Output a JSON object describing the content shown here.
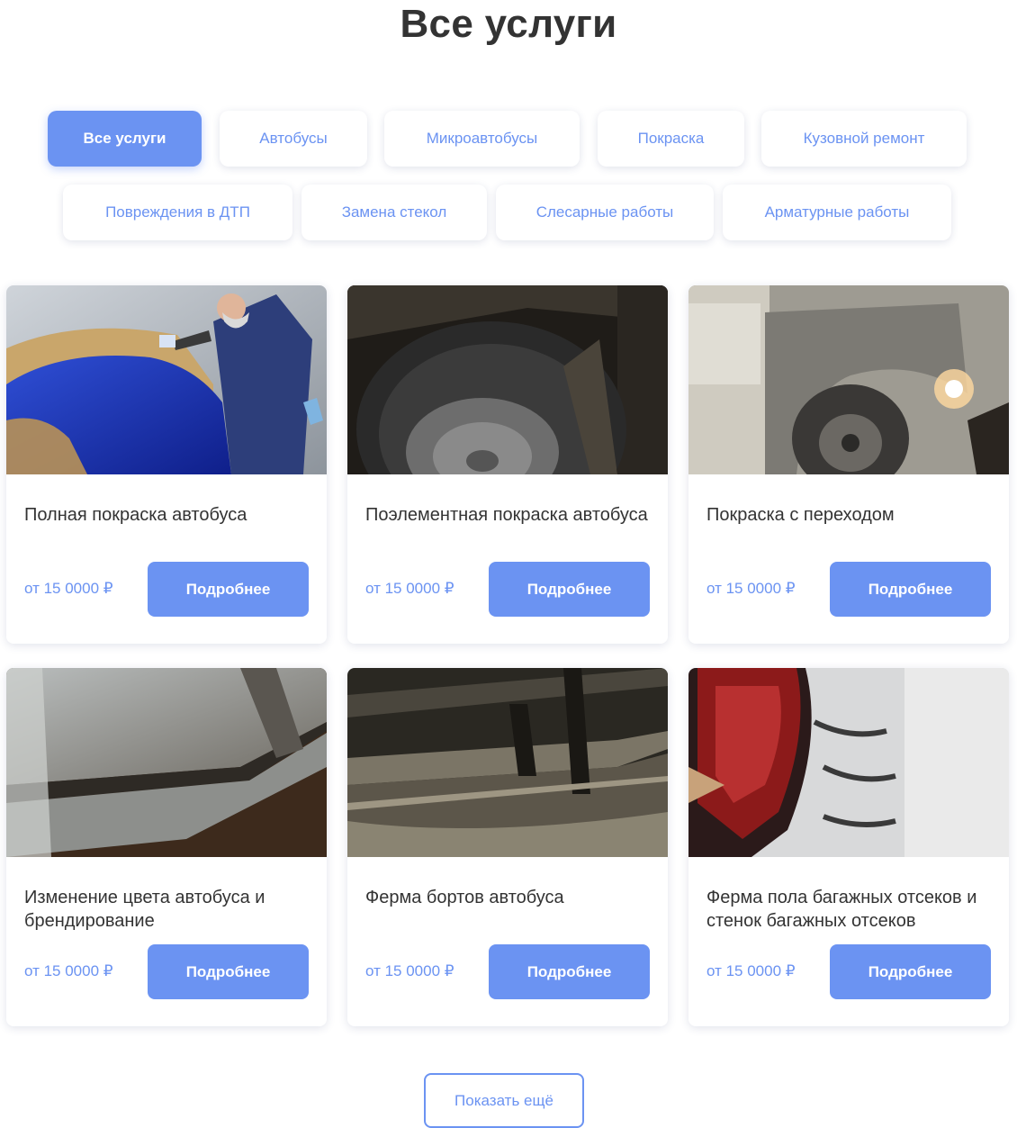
{
  "page": {
    "title": "Все услуги"
  },
  "filters": [
    {
      "label": "Все услуги",
      "active": true
    },
    {
      "label": "Автобусы",
      "active": false
    },
    {
      "label": "Микроавтобусы",
      "active": false
    },
    {
      "label": "Покраска",
      "active": false
    },
    {
      "label": "Кузовной ремонт",
      "active": false
    },
    {
      "label": "Повреждения в ДТП",
      "active": false
    },
    {
      "label": "Замена стекол",
      "active": false
    },
    {
      "label": "Слесарные работы",
      "active": false
    },
    {
      "label": "Арматурные работы",
      "active": false
    }
  ],
  "services": [
    {
      "title": "Полная покраска автобуса",
      "price": "от 15 0000 ₽",
      "button": "Подробнее",
      "image": "photo-painter-spraying-blue-car"
    },
    {
      "title": "Поэлементная покраска автобуса",
      "price": "от 15 0000 ₽",
      "button": "Подробнее",
      "image": "photo-bus-wheel-closeup"
    },
    {
      "title": "Покраска с переходом",
      "price": "от 15 0000 ₽",
      "button": "Подробнее",
      "image": "photo-welding-bus-wheel-arch"
    },
    {
      "title": "Изменение цвета автобуса и брендирование",
      "price": "от 15 0000 ₽",
      "button": "Подробнее",
      "image": "photo-primed-bus-side-panel"
    },
    {
      "title": "Ферма бортов автобуса",
      "price": "от 15 0000 ₽",
      "button": "Подробнее",
      "image": "photo-bus-frame-side"
    },
    {
      "title": "Ферма пола багажных отсеков и стенок багажных отсеков",
      "price": "от 15 0000 ₽",
      "button": "Подробнее",
      "image": "photo-welded-bus-rear-corner"
    }
  ],
  "show_more": {
    "label": "Показать ещё"
  },
  "colors": {
    "accent": "#6b93f2",
    "title": "#333333",
    "card_bg": "#ffffff"
  }
}
